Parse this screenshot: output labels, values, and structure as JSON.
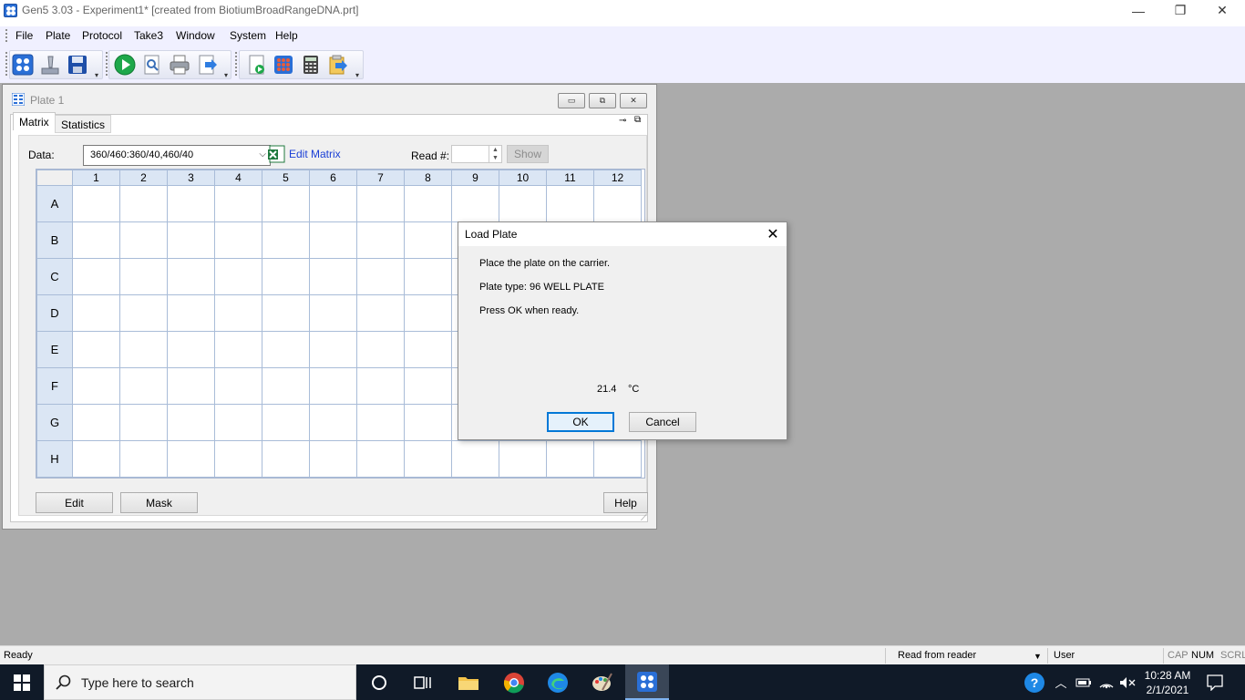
{
  "window": {
    "title": "Gen5 3.03 - Experiment1* [created from BiotiumBroadRangeDNA.prt]",
    "minimize_glyph": "—",
    "restore_glyph": "❐",
    "close_glyph": "✕"
  },
  "menu": [
    "File",
    "Plate",
    "Protocol",
    "Take3",
    "Window",
    "System",
    "Help"
  ],
  "toolbar": {
    "icons": [
      "task-manager-icon",
      "read-plate-icon",
      "save-icon",
      "run-icon",
      "preview-icon",
      "print-icon",
      "export-icon",
      "new-protocol-icon",
      "plate-layout-icon",
      "calculator-icon",
      "export-builder-icon"
    ]
  },
  "plate_window": {
    "title": "Plate 1",
    "tabs": [
      "Matrix",
      "Statistics"
    ],
    "data_label": "Data:",
    "data_value": "360/460:360/40,460/40",
    "edit_matrix": "Edit Matrix",
    "read_label": "Read #:",
    "read_value": "",
    "show_button": "Show",
    "columns": [
      "1",
      "2",
      "3",
      "4",
      "5",
      "6",
      "7",
      "8",
      "9",
      "10",
      "11",
      "12"
    ],
    "rows": [
      "A",
      "B",
      "C",
      "D",
      "E",
      "F",
      "G",
      "H"
    ],
    "edit_button": "Edit",
    "mask_button": "Mask",
    "help_button": "Help"
  },
  "dialog": {
    "title": "Load Plate",
    "line1": "Place the plate on the carrier.",
    "line2": "Plate type: 96 WELL PLATE",
    "line3": "Press OK when ready.",
    "temperature": "21.4",
    "temp_unit": "°C",
    "ok": "OK",
    "cancel": "Cancel"
  },
  "statusbar": {
    "status": "Ready",
    "mode": "Read from reader",
    "user": "User",
    "cap": "CAP",
    "num": "NUM",
    "scrl": "SCRL"
  },
  "taskbar": {
    "search_placeholder": "Type here to search",
    "time": "10:28 AM",
    "date": "2/1/2021"
  }
}
